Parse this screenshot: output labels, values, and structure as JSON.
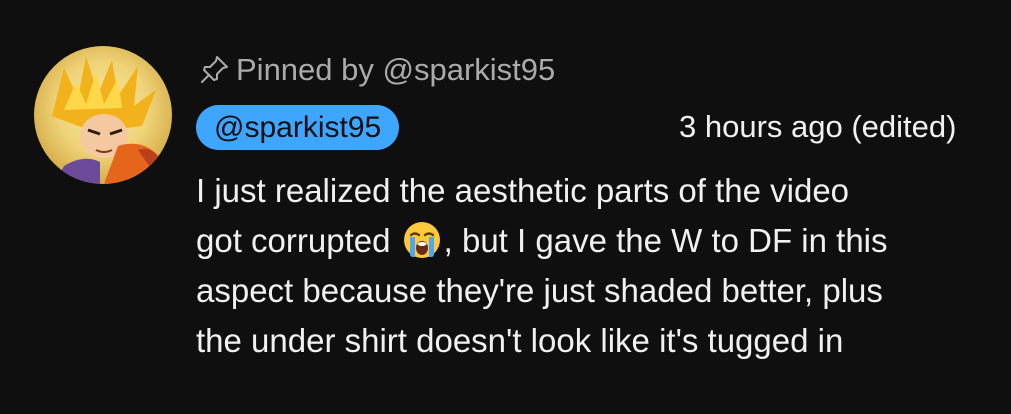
{
  "comment": {
    "avatar_icon": "anime-character-avatar",
    "pinned_by_text": "Pinned by @sparkist95",
    "pin_icon": "pin-icon",
    "author": "@sparkist95",
    "author_badge_color": "#3ea6ff",
    "timestamp": "3 hours ago (edited)",
    "body": {
      "line1": "I just realized the aesthetic parts of the video",
      "line2_before_emoji": "got corrupted",
      "emoji": "loudly-crying-face-emoji",
      "line2_after_emoji": ", but I gave the W to DF in this",
      "line3": "aspect because they're just shaded better, plus",
      "line4": "the under shirt doesn't look like it's tugged in"
    }
  }
}
